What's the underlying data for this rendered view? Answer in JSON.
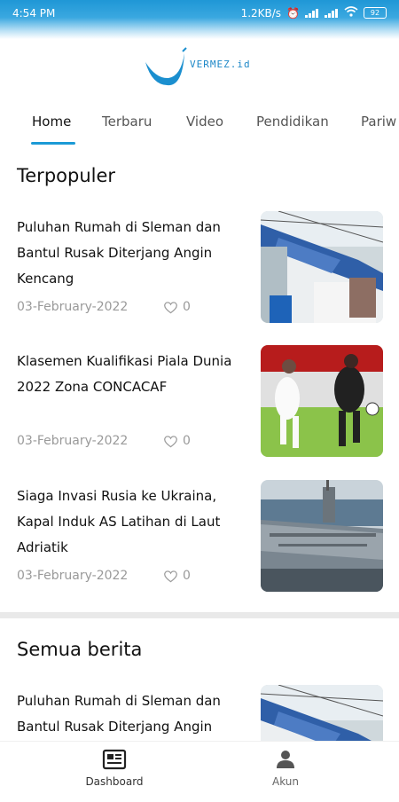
{
  "status": {
    "time": "4:54 PM",
    "speed": "1.2KB/s",
    "battery": "92"
  },
  "brand": {
    "name": "VERMEZ.id"
  },
  "tabs": [
    {
      "label": "Home",
      "active": true
    },
    {
      "label": "Terbaru"
    },
    {
      "label": "Video"
    },
    {
      "label": "Pendidikan"
    },
    {
      "label": "Pariw"
    }
  ],
  "sections": {
    "popular_title": "Terpopuler",
    "all_title": "Semua berita"
  },
  "popular": [
    {
      "title": "Puluhan Rumah di Sleman dan Bantul Rusak Diterjang Angin Kencang",
      "date": "03-February-2022",
      "likes": "0",
      "image": "damaged-roof-photo"
    },
    {
      "title": "Klasemen Kualifikasi Piala Dunia 2022 Zona CONCACAF",
      "date": "03-February-2022",
      "likes": "0",
      "image": "football-match-photo"
    },
    {
      "title": "Siaga Invasi Rusia ke Ukraina, Kapal Induk AS Latihan di Laut Adriatik",
      "date": "03-February-2022",
      "likes": "0",
      "image": "aircraft-carrier-photo"
    }
  ],
  "all_news": [
    {
      "title": "Puluhan Rumah di Sleman dan Bantul Rusak Diterjang Angin Kencang",
      "image": "damaged-roof-photo"
    }
  ],
  "bottom_nav": [
    {
      "label": "Dashboard",
      "icon": "newspaper-icon",
      "active": true
    },
    {
      "label": "Akun",
      "icon": "person-icon"
    }
  ],
  "colors": {
    "accent": "#1b9ad6",
    "muted": "#9a9a9a"
  }
}
